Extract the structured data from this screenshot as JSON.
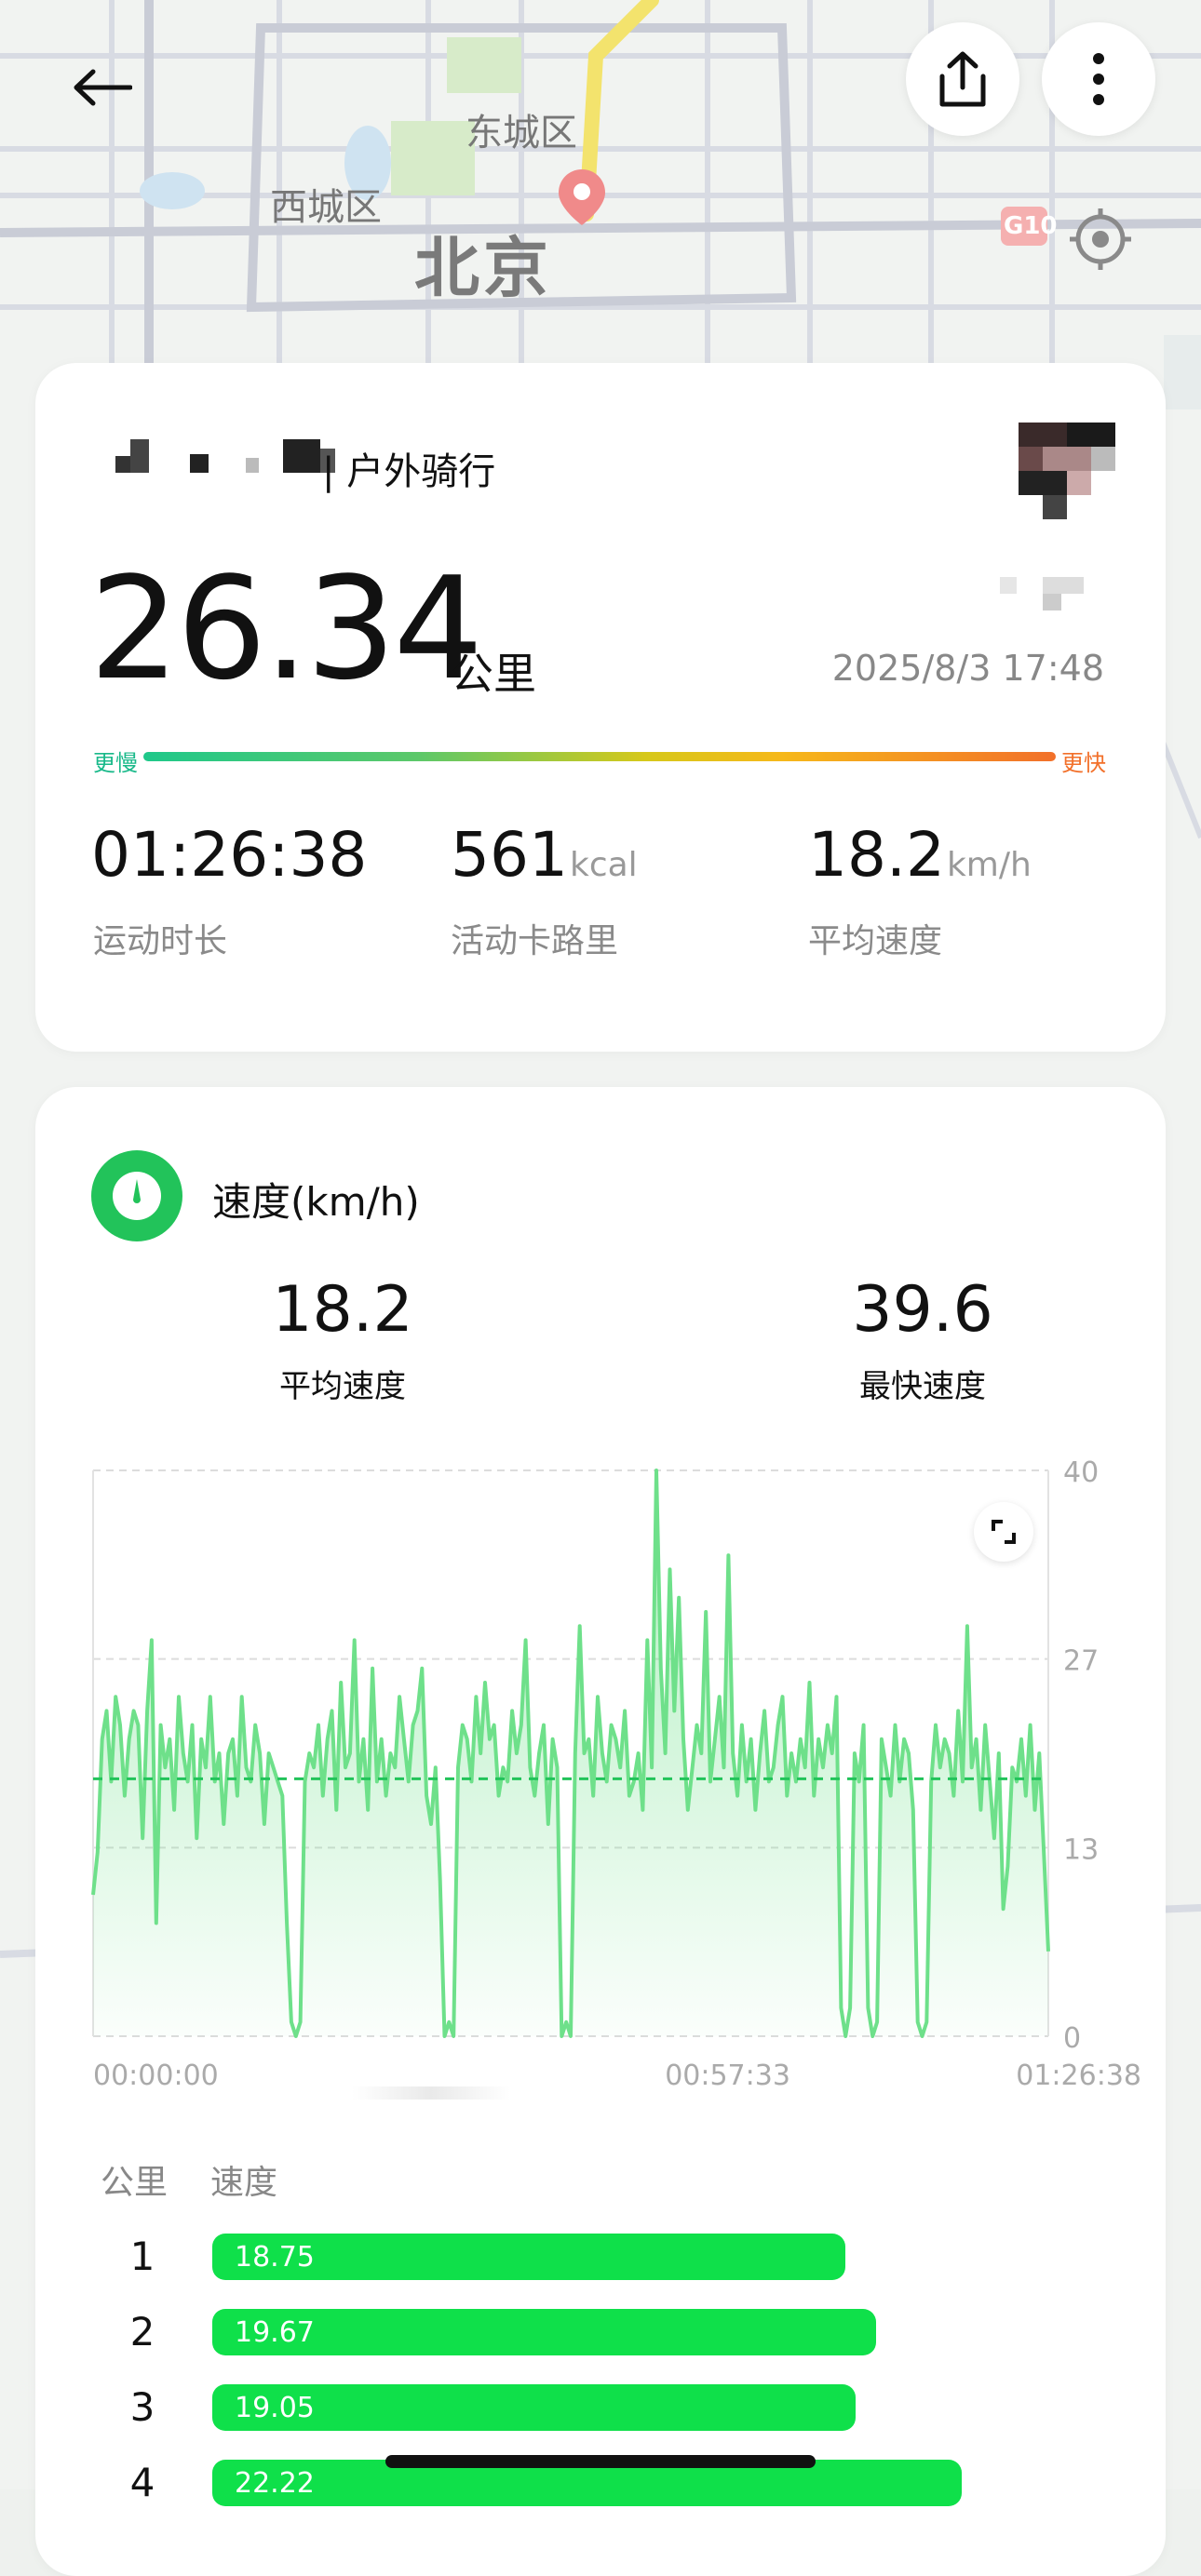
{
  "map": {
    "labels": {
      "district_east": "东城区",
      "district_west": "西城区",
      "city": "北京",
      "road_badge": "G10"
    }
  },
  "icons": {
    "back": "arrow-left-icon",
    "share": "share-icon",
    "more": "more-vertical-icon",
    "locate": "locate-target-icon"
  },
  "summary": {
    "activity_type": "| 户外骑行",
    "distance": "26.34",
    "distance_unit": "公里",
    "datetime": "2025/8/3 17:48",
    "pace_slow": "更慢",
    "pace_fast": "更快",
    "stats": [
      {
        "value": "01:26:38",
        "unit": "",
        "label": "运动时长"
      },
      {
        "value": "561",
        "unit": "kcal",
        "label": "活动卡路里"
      },
      {
        "value": "18.2",
        "unit": "km/h",
        "label": "平均速度"
      }
    ]
  },
  "speed_section": {
    "title": "速度(km/h)",
    "avg_value": "18.2",
    "avg_label": "平均速度",
    "max_value": "39.6",
    "max_label": "最快速度"
  },
  "chart_data": {
    "type": "area",
    "y_ticks": [
      "40",
      "27",
      "13",
      "0"
    ],
    "ylim": [
      0,
      40
    ],
    "x_ticks": [
      "00:00:00",
      "00:57:33",
      "01:26:38"
    ],
    "x_range_seconds": [
      0,
      5198
    ],
    "average": 18.2,
    "max": 39.6,
    "line_color": "#6ee08a",
    "series": [
      {
        "values": [
          10,
          13,
          21,
          23,
          18,
          24,
          22,
          17,
          21,
          23,
          22,
          14,
          23,
          28,
          8,
          22,
          19,
          21,
          16,
          24,
          20,
          18,
          22,
          14,
          21,
          19,
          24,
          18,
          20,
          15,
          20,
          21,
          17,
          24,
          19,
          18,
          22,
          20,
          15,
          20,
          19,
          18,
          17,
          8,
          1,
          0,
          1,
          18,
          20,
          19,
          22,
          17,
          21,
          23,
          16,
          25,
          19,
          20,
          28,
          18,
          21,
          16,
          26,
          18,
          21,
          17,
          20,
          19,
          24,
          21,
          18,
          22,
          23,
          26,
          17,
          15,
          19,
          11,
          0,
          1,
          0,
          19,
          22,
          21,
          18,
          24,
          20,
          25,
          21,
          22,
          17,
          19,
          18,
          23,
          20,
          22,
          28,
          19,
          17,
          20,
          22,
          15,
          21,
          19,
          0,
          1,
          0,
          20,
          29,
          20,
          21,
          17,
          24,
          20,
          18,
          22,
          21,
          19,
          23,
          17,
          18,
          20,
          16,
          28,
          19,
          40,
          26,
          20,
          33,
          23,
          31,
          21,
          16,
          19,
          22,
          20,
          30,
          18,
          21,
          24,
          19,
          34,
          20,
          17,
          22,
          18,
          21,
          16,
          20,
          23,
          18,
          19,
          22,
          24,
          17,
          20,
          18,
          21,
          19,
          25,
          17,
          21,
          19,
          22,
          20,
          24,
          2,
          0,
          2,
          20,
          18,
          22,
          2,
          0,
          1,
          21,
          19,
          17,
          22,
          18,
          21,
          20,
          16,
          1,
          0,
          1,
          18,
          22,
          19,
          21,
          20,
          17,
          23,
          18,
          29,
          19,
          21,
          16,
          22,
          18,
          14,
          20,
          9,
          12,
          19,
          18,
          21,
          17,
          22,
          16,
          20,
          13,
          6
        ]
      }
    ]
  },
  "km_table": {
    "col_km": "公里",
    "col_speed": "速度",
    "rows": [
      {
        "km": "1",
        "speed": "18.75",
        "speed_value": 18.75
      },
      {
        "km": "2",
        "speed": "19.67",
        "speed_value": 19.67
      },
      {
        "km": "3",
        "speed": "19.05",
        "speed_value": 19.05
      },
      {
        "km": "4",
        "speed": "22.22",
        "speed_value": 22.22
      }
    ]
  }
}
